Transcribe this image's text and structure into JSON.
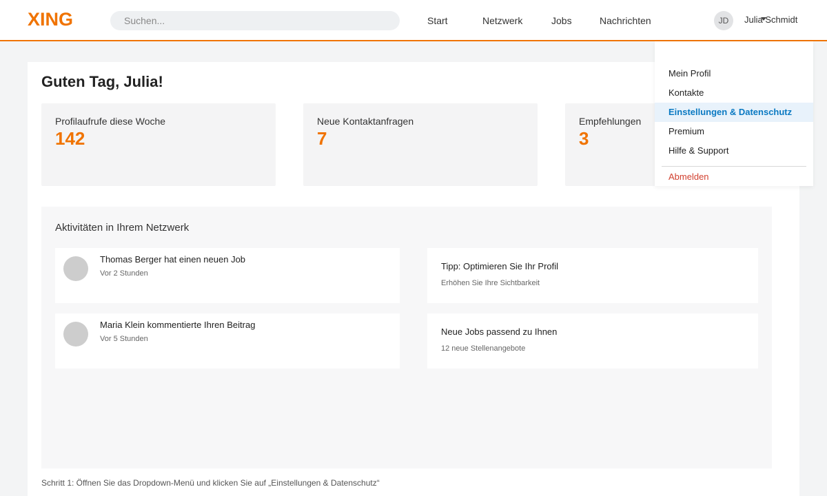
{
  "header": {
    "logo": "XING",
    "search_placeholder": "Suchen...",
    "nav": [
      "Start",
      "Netzwerk",
      "Jobs",
      "Nachrichten"
    ],
    "avatar_initials": "JD",
    "username": "Julia Schmidt"
  },
  "main": {
    "greeting": "Guten Tag, Julia!",
    "stats": [
      {
        "label": "Profilaufrufe diese Woche",
        "value": "142"
      },
      {
        "label": "Neue Kontaktanfragen",
        "value": "7"
      },
      {
        "label": "Empfehlungen",
        "value": "3"
      }
    ],
    "activity": {
      "title": "Aktivitäten in Ihrem Netzwerk",
      "items": [
        {
          "title": "Thomas Berger hat einen neuen Job",
          "time": "Vor 2 Stunden"
        },
        {
          "title": "Maria Klein kommentierte Ihren Beitrag",
          "time": "Vor 5 Stunden"
        }
      ],
      "tips": [
        {
          "title": "Tipp: Optimieren Sie Ihr Profil",
          "sub": "Erhöhen Sie Ihre Sichtbarkeit"
        },
        {
          "title": "Neue Jobs passend zu Ihnen",
          "sub": "12 neue Stellenangebote"
        }
      ]
    },
    "footer_note": "Schritt 1: Öffnen Sie das Dropdown-Menü und klicken Sie auf „Einstellungen & Datenschutz“"
  },
  "dropdown": {
    "items": [
      "Mein Profil",
      "Kontakte",
      "Einstellungen & Datenschutz",
      "Premium",
      "Hilfe & Support"
    ],
    "active_index": 2,
    "logout": "Abmelden"
  },
  "colors": {
    "brand": "#f07300",
    "link_active": "#0a79c2",
    "logout": "#d13f2e"
  },
  "icons": {
    "dropdown_caret": "chevron-down-icon"
  }
}
